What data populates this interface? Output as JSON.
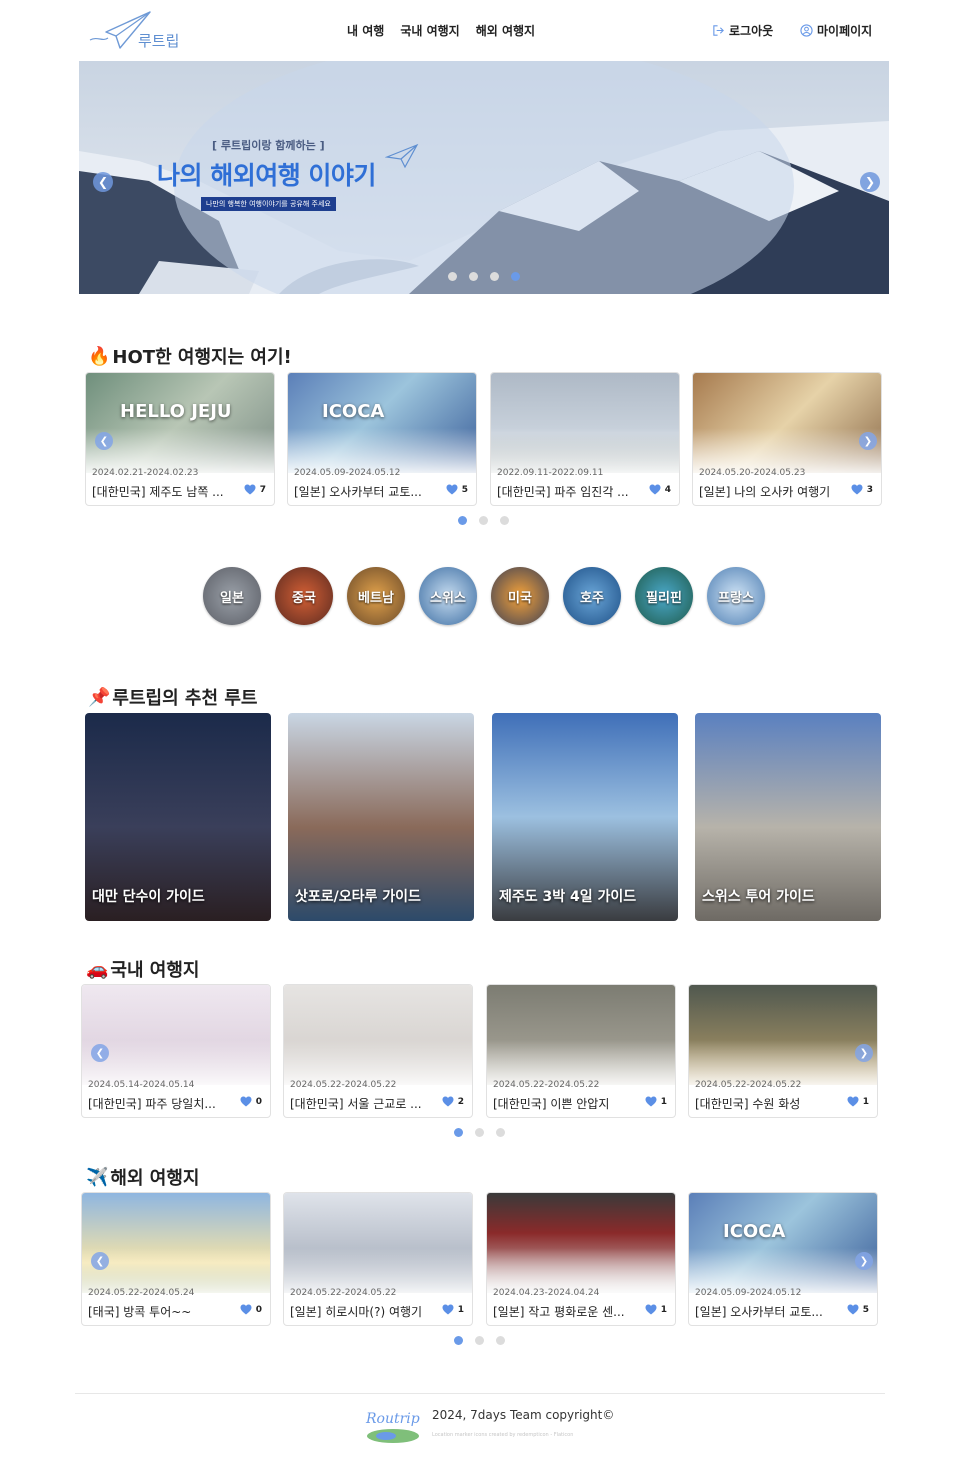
{
  "header": {
    "logo_text": "루트립",
    "nav": [
      "내 여행",
      "국내 여행지",
      "해외 여행지"
    ],
    "logout": "로그아웃",
    "mypage": "마이페이지"
  },
  "banner": {
    "subtitle": "[ 루트립이랑 함께하는 ]",
    "title": "나의 해외여행 이야기",
    "tag": "나만의 행복한 여행이야기를 공유해 주세요",
    "slide_count": 4,
    "active_slide": 4
  },
  "hot": {
    "title": "HOT한 여행지는 여기!",
    "emoji": "🔥",
    "cards": [
      {
        "date": "2024.02.21-2024.02.23",
        "title": "[대한민국] 제주도 남쪽 ...",
        "likes": "7",
        "overlay": "HELLO JEJU"
      },
      {
        "date": "2024.05.09-2024.05.12",
        "title": "[일본] 오사카부터 교토...",
        "likes": "5",
        "overlay": "ICOCA"
      },
      {
        "date": "2022.09.11-2022.09.11",
        "title": "[대한민국] 파주 임진각 ...",
        "likes": "4",
        "overlay": ""
      },
      {
        "date": "2024.05.20-2024.05.23",
        "title": "[일본] 나의 오사카 여행기",
        "likes": "3",
        "overlay": ""
      }
    ],
    "page_count": 3,
    "active_page": 1
  },
  "countries": [
    "일본",
    "중국",
    "베트남",
    "스위스",
    "미국",
    "호주",
    "필리핀",
    "프랑스"
  ],
  "recommend": {
    "title": "루트립의 추천 루트",
    "emoji": "📌",
    "routes": [
      "대만 단수이 가이드",
      "삿포로/오타루 가이드",
      "제주도 3박 4일 가이드",
      "스위스 투어 가이드"
    ]
  },
  "domestic": {
    "title": "국내 여행지",
    "emoji": "🚗",
    "cards": [
      {
        "date": "2024.05.14-2024.05.14",
        "title": "[대한민국] 파주 당일치...",
        "likes": "0"
      },
      {
        "date": "2024.05.22-2024.05.22",
        "title": "[대한민국] 서울 근교로 ...",
        "likes": "2"
      },
      {
        "date": "2024.05.22-2024.05.22",
        "title": "[대한민국] 이쁜 안압지",
        "likes": "1"
      },
      {
        "date": "2024.05.22-2024.05.22",
        "title": "[대한민국] 수원 화성",
        "likes": "1"
      }
    ],
    "page_count": 3,
    "active_page": 1
  },
  "overseas": {
    "title": "해외 여행지",
    "emoji": "✈️",
    "cards": [
      {
        "date": "2024.05.22-2024.05.24",
        "title": "[태국] 방콕 투어~~",
        "likes": "0"
      },
      {
        "date": "2024.05.22-2024.05.22",
        "title": "[일본] 히로시마(?) 여행기",
        "likes": "1"
      },
      {
        "date": "2024.04.23-2024.04.24",
        "title": "[일본] 작고 평화로운 센...",
        "likes": "1"
      },
      {
        "date": "2024.05.09-2024.05.12",
        "title": "[일본] 오사카부터 교토...",
        "likes": "5",
        "overlay": "ICOCA"
      }
    ],
    "page_count": 3,
    "active_page": 1
  },
  "footer": {
    "logo_text": "Routrip",
    "copyright": "2024, 7days Team copyright©",
    "credit": "Location marker icons created by redempticon - Flaticon"
  },
  "colors": {
    "accent": "#6a9ae8",
    "heart": "#5b8fe6"
  }
}
